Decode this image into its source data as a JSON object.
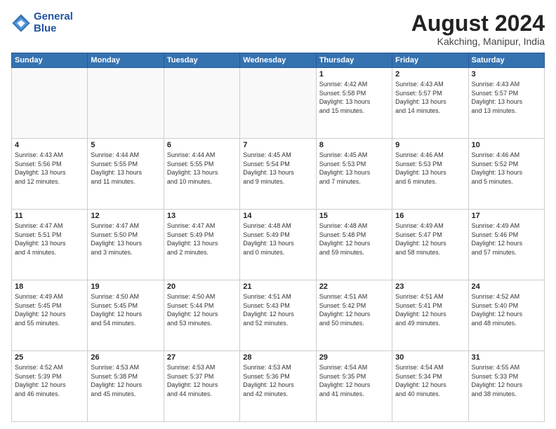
{
  "header": {
    "logo_line1": "General",
    "logo_line2": "Blue",
    "month_title": "August 2024",
    "location": "Kakching, Manipur, India"
  },
  "days_of_week": [
    "Sunday",
    "Monday",
    "Tuesday",
    "Wednesday",
    "Thursday",
    "Friday",
    "Saturday"
  ],
  "weeks": [
    [
      {
        "num": "",
        "info": ""
      },
      {
        "num": "",
        "info": ""
      },
      {
        "num": "",
        "info": ""
      },
      {
        "num": "",
        "info": ""
      },
      {
        "num": "1",
        "info": "Sunrise: 4:42 AM\nSunset: 5:58 PM\nDaylight: 13 hours\nand 15 minutes."
      },
      {
        "num": "2",
        "info": "Sunrise: 4:43 AM\nSunset: 5:57 PM\nDaylight: 13 hours\nand 14 minutes."
      },
      {
        "num": "3",
        "info": "Sunrise: 4:43 AM\nSunset: 5:57 PM\nDaylight: 13 hours\nand 13 minutes."
      }
    ],
    [
      {
        "num": "4",
        "info": "Sunrise: 4:43 AM\nSunset: 5:56 PM\nDaylight: 13 hours\nand 12 minutes."
      },
      {
        "num": "5",
        "info": "Sunrise: 4:44 AM\nSunset: 5:55 PM\nDaylight: 13 hours\nand 11 minutes."
      },
      {
        "num": "6",
        "info": "Sunrise: 4:44 AM\nSunset: 5:55 PM\nDaylight: 13 hours\nand 10 minutes."
      },
      {
        "num": "7",
        "info": "Sunrise: 4:45 AM\nSunset: 5:54 PM\nDaylight: 13 hours\nand 9 minutes."
      },
      {
        "num": "8",
        "info": "Sunrise: 4:45 AM\nSunset: 5:53 PM\nDaylight: 13 hours\nand 7 minutes."
      },
      {
        "num": "9",
        "info": "Sunrise: 4:46 AM\nSunset: 5:53 PM\nDaylight: 13 hours\nand 6 minutes."
      },
      {
        "num": "10",
        "info": "Sunrise: 4:46 AM\nSunset: 5:52 PM\nDaylight: 13 hours\nand 5 minutes."
      }
    ],
    [
      {
        "num": "11",
        "info": "Sunrise: 4:47 AM\nSunset: 5:51 PM\nDaylight: 13 hours\nand 4 minutes."
      },
      {
        "num": "12",
        "info": "Sunrise: 4:47 AM\nSunset: 5:50 PM\nDaylight: 13 hours\nand 3 minutes."
      },
      {
        "num": "13",
        "info": "Sunrise: 4:47 AM\nSunset: 5:49 PM\nDaylight: 13 hours\nand 2 minutes."
      },
      {
        "num": "14",
        "info": "Sunrise: 4:48 AM\nSunset: 5:49 PM\nDaylight: 13 hours\nand 0 minutes."
      },
      {
        "num": "15",
        "info": "Sunrise: 4:48 AM\nSunset: 5:48 PM\nDaylight: 12 hours\nand 59 minutes."
      },
      {
        "num": "16",
        "info": "Sunrise: 4:49 AM\nSunset: 5:47 PM\nDaylight: 12 hours\nand 58 minutes."
      },
      {
        "num": "17",
        "info": "Sunrise: 4:49 AM\nSunset: 5:46 PM\nDaylight: 12 hours\nand 57 minutes."
      }
    ],
    [
      {
        "num": "18",
        "info": "Sunrise: 4:49 AM\nSunset: 5:45 PM\nDaylight: 12 hours\nand 55 minutes."
      },
      {
        "num": "19",
        "info": "Sunrise: 4:50 AM\nSunset: 5:45 PM\nDaylight: 12 hours\nand 54 minutes."
      },
      {
        "num": "20",
        "info": "Sunrise: 4:50 AM\nSunset: 5:44 PM\nDaylight: 12 hours\nand 53 minutes."
      },
      {
        "num": "21",
        "info": "Sunrise: 4:51 AM\nSunset: 5:43 PM\nDaylight: 12 hours\nand 52 minutes."
      },
      {
        "num": "22",
        "info": "Sunrise: 4:51 AM\nSunset: 5:42 PM\nDaylight: 12 hours\nand 50 minutes."
      },
      {
        "num": "23",
        "info": "Sunrise: 4:51 AM\nSunset: 5:41 PM\nDaylight: 12 hours\nand 49 minutes."
      },
      {
        "num": "24",
        "info": "Sunrise: 4:52 AM\nSunset: 5:40 PM\nDaylight: 12 hours\nand 48 minutes."
      }
    ],
    [
      {
        "num": "25",
        "info": "Sunrise: 4:52 AM\nSunset: 5:39 PM\nDaylight: 12 hours\nand 46 minutes."
      },
      {
        "num": "26",
        "info": "Sunrise: 4:53 AM\nSunset: 5:38 PM\nDaylight: 12 hours\nand 45 minutes."
      },
      {
        "num": "27",
        "info": "Sunrise: 4:53 AM\nSunset: 5:37 PM\nDaylight: 12 hours\nand 44 minutes."
      },
      {
        "num": "28",
        "info": "Sunrise: 4:53 AM\nSunset: 5:36 PM\nDaylight: 12 hours\nand 42 minutes."
      },
      {
        "num": "29",
        "info": "Sunrise: 4:54 AM\nSunset: 5:35 PM\nDaylight: 12 hours\nand 41 minutes."
      },
      {
        "num": "30",
        "info": "Sunrise: 4:54 AM\nSunset: 5:34 PM\nDaylight: 12 hours\nand 40 minutes."
      },
      {
        "num": "31",
        "info": "Sunrise: 4:55 AM\nSunset: 5:33 PM\nDaylight: 12 hours\nand 38 minutes."
      }
    ]
  ]
}
